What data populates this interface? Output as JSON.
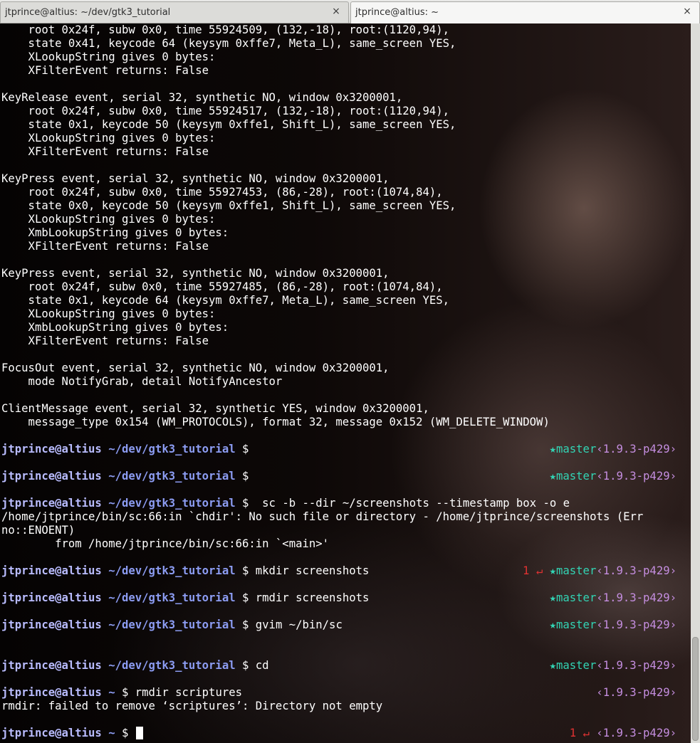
{
  "tabs": [
    {
      "title": "jtprince@altius: ~/dev/gtk3_tutorial",
      "close": "×"
    },
    {
      "title": "jtprince@altius: ~",
      "close": "×"
    }
  ],
  "colors": {
    "prompt_user": "#b9bcff",
    "prompt_path": "#8c9cf2",
    "status_red": "#e03232",
    "branch_teal": "#32d4b4",
    "ruby_purple": "#c58ee0"
  },
  "output_top": [
    "    root 0x24f, subw 0x0, time 55924509, (132,-18), root:(1120,94),",
    "    state 0x41, keycode 64 (keysym 0xffe7, Meta_L), same_screen YES,",
    "    XLookupString gives 0 bytes:",
    "    XFilterEvent returns: False",
    "",
    "KeyRelease event, serial 32, synthetic NO, window 0x3200001,",
    "    root 0x24f, subw 0x0, time 55924517, (132,-18), root:(1120,94),",
    "    state 0x1, keycode 50 (keysym 0xffe1, Shift_L), same_screen YES,",
    "    XLookupString gives 0 bytes:",
    "    XFilterEvent returns: False",
    "",
    "KeyPress event, serial 32, synthetic NO, window 0x3200001,",
    "    root 0x24f, subw 0x0, time 55927453, (86,-28), root:(1074,84),",
    "    state 0x0, keycode 50 (keysym 0xffe1, Shift_L), same_screen YES,",
    "    XLookupString gives 0 bytes:",
    "    XmbLookupString gives 0 bytes:",
    "    XFilterEvent returns: False",
    "",
    "KeyPress event, serial 32, synthetic NO, window 0x3200001,",
    "    root 0x24f, subw 0x0, time 55927485, (86,-28), root:(1074,84),",
    "    state 0x1, keycode 64 (keysym 0xffe7, Meta_L), same_screen YES,",
    "    XLookupString gives 0 bytes:",
    "    XmbLookupString gives 0 bytes:",
    "    XFilterEvent returns: False",
    "",
    "FocusOut event, serial 32, synthetic NO, window 0x3200001,",
    "    mode NotifyGrab, detail NotifyAncestor",
    "",
    "ClientMessage event, serial 32, synthetic YES, window 0x3200001,",
    "    message_type 0x154 (WM_PROTOCOLS), format 32, message 0x152 (WM_DELETE_WINDOW)",
    ""
  ],
  "session": [
    {
      "type": "prompt",
      "user": "jtprince@altius",
      "path": "~/dev/gtk3_tutorial",
      "sym": "$",
      "cmd": "",
      "status": "",
      "branch": "★master",
      "ruby": "‹1.9.3-p429›"
    },
    {
      "type": "blank"
    },
    {
      "type": "prompt",
      "user": "jtprince@altius",
      "path": "~/dev/gtk3_tutorial",
      "sym": "$",
      "cmd": "",
      "status": "",
      "branch": "★master",
      "ruby": "‹1.9.3-p429›"
    },
    {
      "type": "blank"
    },
    {
      "type": "prompt",
      "user": "jtprince@altius",
      "path": "~/dev/gtk3_tutorial",
      "sym": "$",
      "cmd": "  sc -b --dir ~/screenshots --timestamp box -o e",
      "status": "",
      "branch": "",
      "ruby": ""
    },
    {
      "type": "out",
      "text": "/home/jtprince/bin/sc:66:in `chdir': No such file or directory - /home/jtprince/screenshots (Err"
    },
    {
      "type": "out",
      "text": "no::ENOENT)"
    },
    {
      "type": "out",
      "text": "        from /home/jtprince/bin/sc:66:in `<main>'"
    },
    {
      "type": "blank"
    },
    {
      "type": "prompt",
      "user": "jtprince@altius",
      "path": "~/dev/gtk3_tutorial",
      "sym": "$",
      "cmd": " mkdir screenshots",
      "status": "1 ↵",
      "branch": "★master",
      "ruby": "‹1.9.3-p429›"
    },
    {
      "type": "blank"
    },
    {
      "type": "prompt",
      "user": "jtprince@altius",
      "path": "~/dev/gtk3_tutorial",
      "sym": "$",
      "cmd": " rmdir screenshots",
      "status": "",
      "branch": "★master",
      "ruby": "‹1.9.3-p429›"
    },
    {
      "type": "blank"
    },
    {
      "type": "prompt",
      "user": "jtprince@altius",
      "path": "~/dev/gtk3_tutorial",
      "sym": "$",
      "cmd": " gvim ~/bin/sc",
      "status": "",
      "branch": "★master",
      "ruby": "‹1.9.3-p429›"
    },
    {
      "type": "blank"
    },
    {
      "type": "blank"
    },
    {
      "type": "prompt",
      "user": "jtprince@altius",
      "path": "~/dev/gtk3_tutorial",
      "sym": "$",
      "cmd": " cd",
      "status": "",
      "branch": "★master",
      "ruby": "‹1.9.3-p429›"
    },
    {
      "type": "blank"
    },
    {
      "type": "prompt",
      "user": "jtprince@altius",
      "path": "~",
      "sym": "$",
      "cmd": " rmdir scriptures",
      "status": "",
      "branch": "",
      "ruby": "‹1.9.3-p429›"
    },
    {
      "type": "out",
      "text": "rmdir: failed to remove ‘scriptures’: Directory not empty"
    },
    {
      "type": "blank"
    },
    {
      "type": "prompt",
      "user": "jtprince@altius",
      "path": "~",
      "sym": "$",
      "cmd": " ",
      "status": "1 ↵",
      "branch": "",
      "ruby": "‹1.9.3-p429›",
      "cursor": true
    }
  ]
}
